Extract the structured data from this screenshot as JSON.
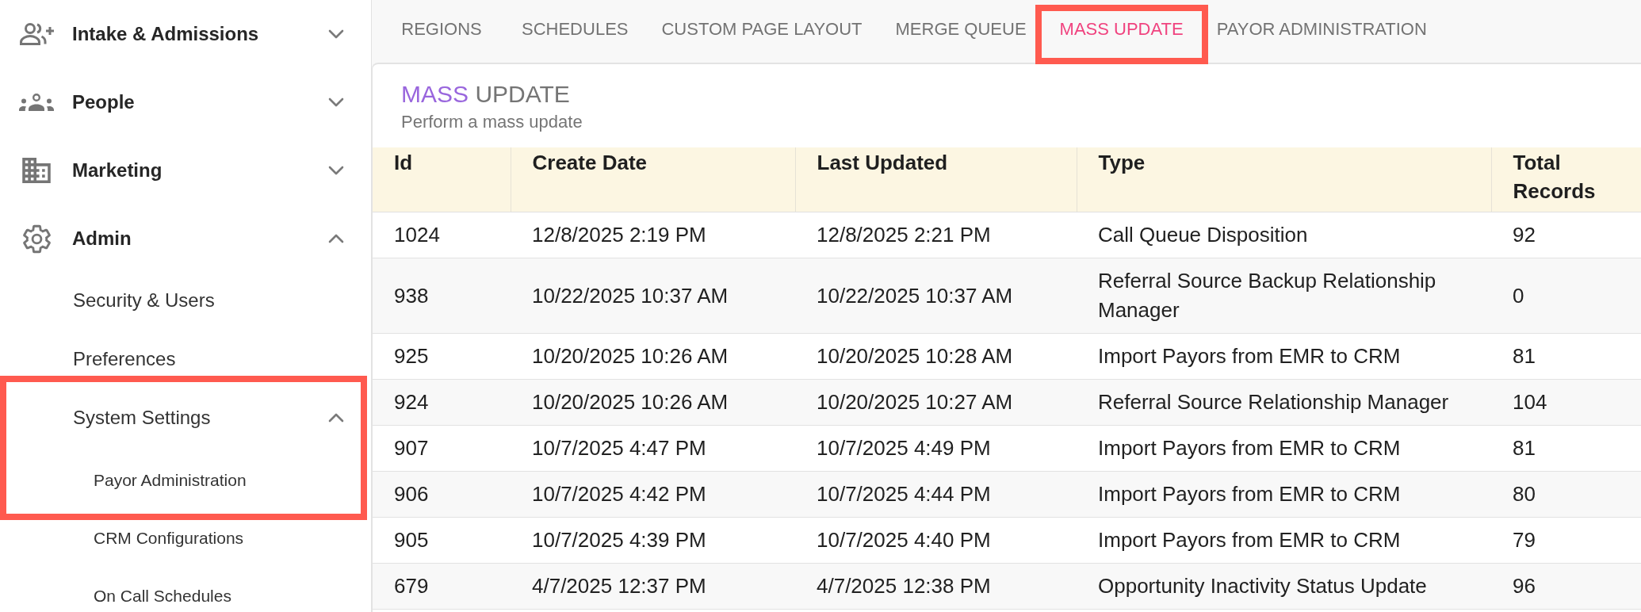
{
  "sidebar": {
    "items": [
      {
        "label": "Intake & Admissions",
        "expanded": false,
        "highlighted": false
      },
      {
        "label": "People",
        "expanded": false,
        "highlighted": false
      },
      {
        "label": "Marketing",
        "expanded": false,
        "highlighted": false
      },
      {
        "label": "Admin",
        "expanded": true,
        "highlighted": false,
        "children": [
          {
            "label": "Security & Users",
            "highlighted": false
          },
          {
            "label": "Preferences",
            "highlighted": false
          },
          {
            "label": "System Settings",
            "expanded": true,
            "highlighted": true,
            "children": [
              {
                "label": "Payor Administration",
                "highlighted": true
              },
              {
                "label": "CRM Configurations",
                "highlighted": false
              },
              {
                "label": "On Call Schedules",
                "highlighted": false
              }
            ]
          }
        ]
      }
    ]
  },
  "tabs": [
    {
      "label": "REGIONS",
      "selected": false,
      "highlighted": false
    },
    {
      "label": "SCHEDULES",
      "selected": false,
      "highlighted": false
    },
    {
      "label": "CUSTOM PAGE LAYOUT",
      "selected": false,
      "highlighted": false
    },
    {
      "label": "MERGE QUEUE",
      "selected": false,
      "highlighted": false
    },
    {
      "label": "MASS UPDATE",
      "selected": true,
      "highlighted": true
    },
    {
      "label": "PAYOR ADMINISTRATION",
      "selected": false,
      "highlighted": false
    }
  ],
  "page": {
    "title": {
      "accent": "MASS",
      "text": "UPDATE"
    },
    "subtitle": "Perform a mass update"
  },
  "table": {
    "columns": [
      "Id",
      "Create Date",
      "Last Updated",
      "Type",
      "Total Records"
    ],
    "rows": [
      [
        "1024",
        "12/8/2025 2:19 PM",
        "12/8/2025 2:21 PM",
        "Call Queue Disposition",
        "92"
      ],
      [
        "938",
        "10/22/2025 10:37 AM",
        "10/22/2025 10:37 AM",
        "Referral Source Backup Relationship Manager",
        "0"
      ],
      [
        "925",
        "10/20/2025 10:26 AM",
        "10/20/2025 10:28 AM",
        "Import Payors from EMR to CRM",
        "81"
      ],
      [
        "924",
        "10/20/2025 10:26 AM",
        "10/20/2025 10:27 AM",
        "Referral Source Relationship Manager",
        "104"
      ],
      [
        "907",
        "10/7/2025 4:47 PM",
        "10/7/2025 4:49 PM",
        "Import Payors from EMR to CRM",
        "81"
      ],
      [
        "906",
        "10/7/2025 4:42 PM",
        "10/7/2025 4:44 PM",
        "Import Payors from EMR to CRM",
        "80"
      ],
      [
        "905",
        "10/7/2025 4:39 PM",
        "10/7/2025 4:40 PM",
        "Import Payors from EMR to CRM",
        "79"
      ],
      [
        "679",
        "4/7/2025 12:37 PM",
        "4/7/2025 12:38 PM",
        "Opportunity Inactivity Status Update",
        "96"
      ]
    ]
  }
}
